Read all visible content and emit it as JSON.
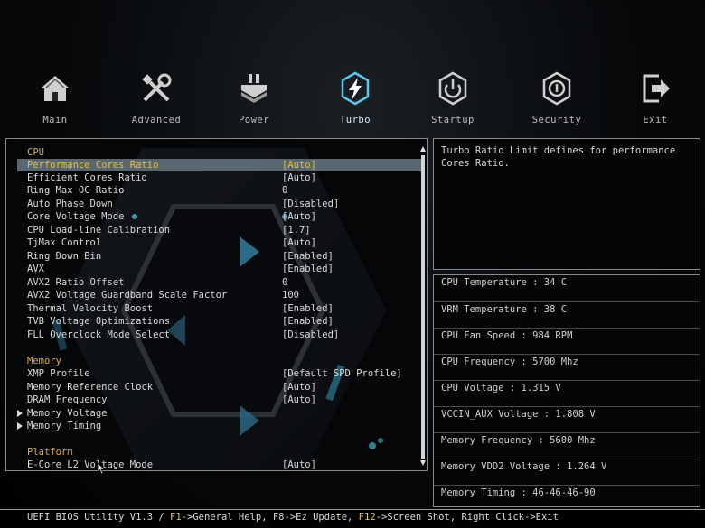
{
  "nav": [
    {
      "label": "Main",
      "icon": "home-icon"
    },
    {
      "label": "Advanced",
      "icon": "tools-icon"
    },
    {
      "label": "Power",
      "icon": "power-chip-icon"
    },
    {
      "label": "Turbo",
      "icon": "turbo-lightning-icon",
      "active": true
    },
    {
      "label": "Startup",
      "icon": "startup-power-icon"
    },
    {
      "label": "Security",
      "icon": "shield-icon"
    },
    {
      "label": "Exit",
      "icon": "exit-icon"
    }
  ],
  "settings": {
    "cpu_header": "CPU",
    "cpu": [
      {
        "name": "Performance Cores Ratio",
        "value": "[Auto]"
      },
      {
        "name": "Efficient Cores Ratio",
        "value": "[Auto]"
      },
      {
        "name": "Ring Max OC Ratio",
        "value": "0"
      },
      {
        "name": "Auto Phase Down",
        "value": "[Disabled]"
      },
      {
        "name": "Core Voltage Mode",
        "value": "[Auto]"
      },
      {
        "name": "CPU Load-line Calibration",
        "value": "[1.7]"
      },
      {
        "name": "TjMax Control",
        "value": "[Auto]"
      },
      {
        "name": "Ring Down Bin",
        "value": "[Enabled]"
      },
      {
        "name": "AVX",
        "value": "[Enabled]"
      },
      {
        "name": "AVX2 Ratio Offset",
        "value": "0"
      },
      {
        "name": "AVX2 Voltage Guardband Scale Factor",
        "value": "100"
      },
      {
        "name": "Thermal Velocity Boost",
        "value": "[Enabled]"
      },
      {
        "name": "TVB Voltage Optimizations",
        "value": "[Enabled]"
      },
      {
        "name": "FLL Overclock Mode Select",
        "value": "[Disabled]"
      }
    ],
    "memory_header": "Memory",
    "memory": [
      {
        "name": "XMP Profile",
        "value": "[Default SPD Profile]"
      },
      {
        "name": "Memory Reference Clock",
        "value": "[Auto]"
      },
      {
        "name": "DRAM Frequency",
        "value": "[Auto]"
      },
      {
        "name": "Memory Voltage",
        "value": ""
      },
      {
        "name": "Memory Timing",
        "value": ""
      }
    ],
    "platform_header": "Platform",
    "platform": [
      {
        "name": "E-Core L2 Voltage Mode",
        "value": "[Auto]"
      }
    ]
  },
  "help_text": "Turbo Ratio Limit defines for performance\nCores Ratio.",
  "info": [
    "CPU Temperature : 34 C",
    "VRM Temperature : 38 C",
    "CPU Fan Speed : 984 RPM",
    "CPU Frequency : 5700 Mhz",
    "CPU Voltage : 1.315 V",
    "VCCIN_AUX Voltage : 1.808 V",
    "Memory Frequency : 5600 Mhz",
    "Memory VDD2 Voltage : 1.264 V",
    "Memory Timing : 46-46-46-90"
  ],
  "status": {
    "prefix": "UEFI BIOS Utility V1.3 / ",
    "f1_key": "F1",
    "f1_text": "->General Help, F8->Ez Update, ",
    "f12_key": "F12",
    "f12_text": "->Screen Shot, Right Click->Exit"
  },
  "colors": {
    "highlight_text": "#e3c13e",
    "section_header": "#e0a84a",
    "selected_row_bg": "#5b6770",
    "turbo_icon": "#5cc8ec"
  }
}
